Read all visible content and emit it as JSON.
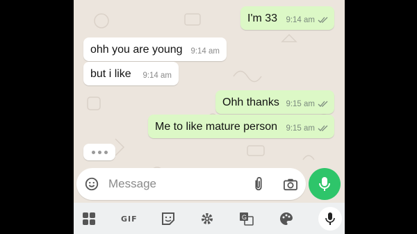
{
  "messages": [
    {
      "direction": "out",
      "text": "I'm 33",
      "time": "9:14 am",
      "status": "read"
    },
    {
      "direction": "in",
      "text": "ohh you are young",
      "time": "9:14 am"
    },
    {
      "direction": "in",
      "text": "but i like",
      "time": "9:14 am"
    },
    {
      "direction": "out",
      "text": "Ohh thanks",
      "time": "9:15 am",
      "status": "read"
    },
    {
      "direction": "out",
      "text": "Me to like mature person",
      "time": "9:15 am",
      "status": "read"
    }
  ],
  "typing_indicator": {
    "visible": true
  },
  "composer": {
    "placeholder": "Message"
  },
  "keyboard_toolbar": {
    "gif_label": "GIF"
  },
  "colors": {
    "incoming": "#ffffff",
    "outgoing": "#dcf8c6",
    "wallpaper": "#ece5dd",
    "accent_green": "#2ec56a",
    "tick": "#7b8a7e"
  },
  "icons": {
    "composer": [
      "emoji-icon",
      "attach-icon",
      "camera-icon"
    ],
    "send": "mic-icon",
    "keyboard": [
      "apps-grid-icon",
      "gif-icon",
      "sticker-icon",
      "settings-gear-icon",
      "translate-icon",
      "palette-icon",
      "voice-input-icon"
    ]
  }
}
